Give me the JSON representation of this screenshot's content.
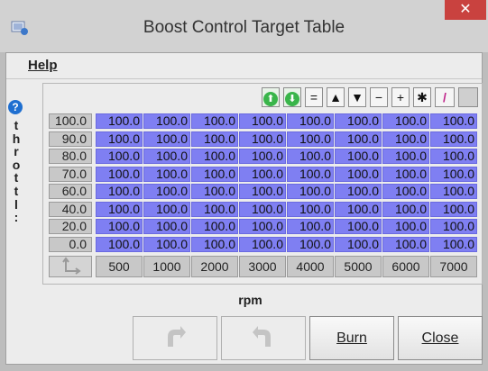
{
  "window": {
    "title": "Boost Control Target Table",
    "close_glyph": "✕"
  },
  "menu": {
    "help": "Help"
  },
  "y_axis_label": "throttl:",
  "x_axis_label": "rpm",
  "toolbar": [
    {
      "name": "increase-icon",
      "glyph": "⬆"
    },
    {
      "name": "decrease-icon",
      "glyph": "⬇"
    },
    {
      "name": "set-equal-button",
      "glyph": "="
    },
    {
      "name": "shift-up-button",
      "glyph": "▲"
    },
    {
      "name": "shift-down-button",
      "glyph": "▼"
    },
    {
      "name": "minus-button",
      "glyph": "−"
    },
    {
      "name": "plus-button",
      "glyph": "+"
    },
    {
      "name": "multiply-button",
      "glyph": "✱"
    },
    {
      "name": "pencil-icon",
      "glyph": "/"
    },
    {
      "name": "color-swatch-button",
      "glyph": ""
    }
  ],
  "table": {
    "y_values": [
      "100.0",
      "90.0",
      "80.0",
      "70.0",
      "60.0",
      "40.0",
      "20.0",
      "0.0"
    ],
    "x_values": [
      "500",
      "1000",
      "2000",
      "3000",
      "4000",
      "5000",
      "6000",
      "7000"
    ],
    "cells": [
      [
        "100.0",
        "100.0",
        "100.0",
        "100.0",
        "100.0",
        "100.0",
        "100.0",
        "100.0"
      ],
      [
        "100.0",
        "100.0",
        "100.0",
        "100.0",
        "100.0",
        "100.0",
        "100.0",
        "100.0"
      ],
      [
        "100.0",
        "100.0",
        "100.0",
        "100.0",
        "100.0",
        "100.0",
        "100.0",
        "100.0"
      ],
      [
        "100.0",
        "100.0",
        "100.0",
        "100.0",
        "100.0",
        "100.0",
        "100.0",
        "100.0"
      ],
      [
        "100.0",
        "100.0",
        "100.0",
        "100.0",
        "100.0",
        "100.0",
        "100.0",
        "100.0"
      ],
      [
        "100.0",
        "100.0",
        "100.0",
        "100.0",
        "100.0",
        "100.0",
        "100.0",
        "100.0"
      ],
      [
        "100.0",
        "100.0",
        "100.0",
        "100.0",
        "100.0",
        "100.0",
        "100.0",
        "100.0"
      ],
      [
        "100.0",
        "100.0",
        "100.0",
        "100.0",
        "100.0",
        "100.0",
        "100.0",
        "100.0"
      ]
    ]
  },
  "buttons": {
    "burn": "Burn",
    "close": "Close"
  },
  "colors": {
    "cell": "#7f7ff2",
    "accent_help": "#1f6fd0",
    "close_red": "#c9423f"
  }
}
